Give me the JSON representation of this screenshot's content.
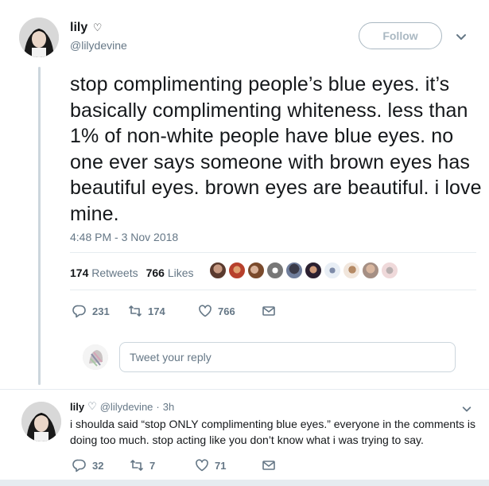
{
  "tweet": {
    "display_name": "lily",
    "heart": "♡",
    "handle": "@lilydevine",
    "follow_label": "Follow",
    "text": "stop complimenting people’s blue eyes. it’s basically complimenting whiteness. less than 1% of non-white people have blue eyes. no one ever says someone with brown eyes has beautiful eyes. brown eyes are beautiful. i love mine.",
    "timestamp": "4:48 PM - 3 Nov 2018",
    "stats": {
      "retweets_count": "174",
      "retweets_label": "Retweets",
      "likes_count": "766",
      "likes_label": "Likes"
    },
    "actions": {
      "replies": "231",
      "retweets": "174",
      "likes": "766"
    }
  },
  "reply_box": {
    "placeholder": "Tweet your reply"
  },
  "reply": {
    "display_name": "lily",
    "heart": "♡",
    "handle": "@lilydevine",
    "separator": "·",
    "time": "3h",
    "text": "i shoulda said “stop ONLY complimenting blue eyes.” everyone in the comments is doing too much. stop acting like you don’t know what i was trying to say.",
    "actions": {
      "replies": "32",
      "retweets": "7",
      "likes": "71"
    }
  },
  "icons": {
    "reply": "reply-icon",
    "retweet": "retweet-icon",
    "like": "heart-icon",
    "dm": "envelope-icon",
    "caret": "chevron-down-icon"
  },
  "colors": {
    "text": "#14171a",
    "muted": "#657786",
    "border": "#e6ecf0",
    "follow_border": "#aab8c2"
  }
}
